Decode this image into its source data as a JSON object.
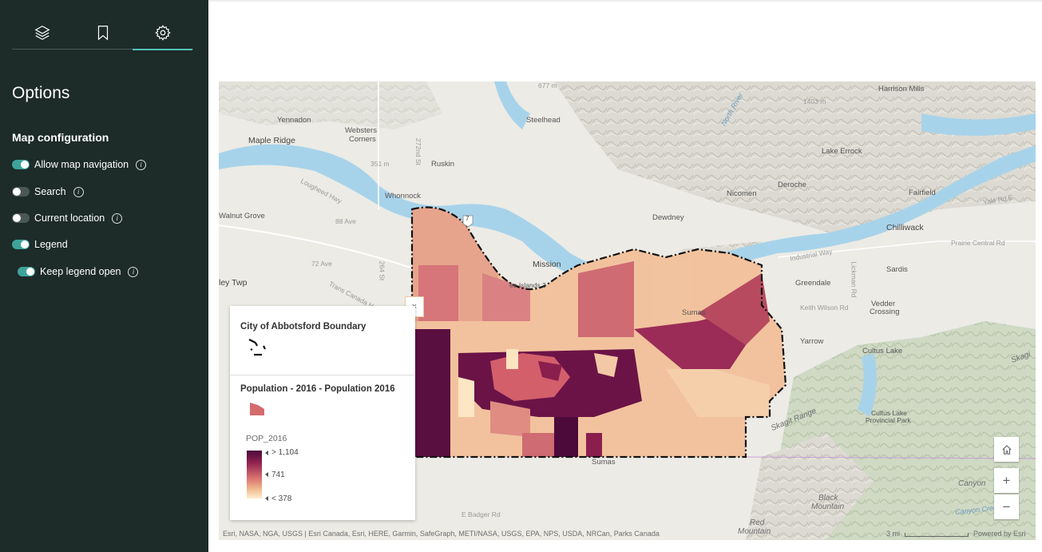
{
  "sidebar": {
    "tabs": [
      {
        "icon": "layers-icon"
      },
      {
        "icon": "bookmark-icon"
      },
      {
        "icon": "gear-icon"
      }
    ],
    "title": "Options",
    "section": "Map configuration",
    "options": [
      {
        "label": "Allow map navigation",
        "on": true
      },
      {
        "label": "Search",
        "on": false
      },
      {
        "label": "Current location",
        "on": false
      },
      {
        "label": "Legend",
        "on": true
      },
      {
        "label": "Keep legend open",
        "on": true
      }
    ]
  },
  "map": {
    "places": {
      "yennadon": "Yennadon",
      "maple_ridge": "Maple Ridge",
      "websters_1": "Websters",
      "websters_2": "Corners",
      "ruskin": "Ruskin",
      "steelhead": "Steelhead",
      "whonnock": "Whonnock",
      "walnut_grove": "Walnut Grove",
      "ave_88": "88 Ave",
      "ave_72": "72 Ave",
      "st_272": "272nd St",
      "st_264": "264 St",
      "lougheed": "Lougheed Hwy",
      "trans_canada": "Trans Canada H",
      "ley_twp": "ley Twp",
      "mission": "Mission",
      "dewdney": "Dewdney",
      "nicomen": "Nicomen",
      "deroche": "Deroche",
      "lake_errock": "Lake Errock",
      "harrison_mills": "Harrison Mills",
      "fairfield": "Fairfield",
      "yale_rd": "Yale Rd E",
      "chilliwack": "Chilliwack",
      "prairie_central": "Prairie Central Rd",
      "industrial_way": "Industrial Way",
      "sardis": "Sardis",
      "greendale": "Greendale",
      "lickman": "Lickman Rd",
      "keith_wilson": "Keith Wilson Rd",
      "vedder_1": "Vedder",
      "vedder_2": "Crossing",
      "yarrow": "Yarrow",
      "cultus_lake": "Cultus Lake",
      "cultus_park_1": "Cultus Lake",
      "cultus_park_2": "Provincial Park",
      "skagit_range": "Skagit Range",
      "skag": "Skagi",
      "sumas_1": "Sumas",
      "sumas_2": "Sumas",
      "canyon": "Canyon",
      "canyon_creek": "Canyon Creek",
      "black_1": "Black",
      "black_2": "Mountain",
      "red_1": "Red",
      "red_2": "Mountain",
      "e_badger": "E Badger Rd",
      "islands3": "ee Islands 3",
      "m677": "677 m",
      "m1403": "1403 m",
      "m351": "351 m",
      "north_river": "North River",
      "hwy7": "7"
    },
    "attribution": "Esri, NASA, NGA, USGS | Esri Canada, Esri, HERE, Garmin, SafeGraph, METI/NASA, USGS, EPA, NPS, USDA, NRCan, Parks Canada",
    "scale": "3 mi",
    "powered": "Powered by Esri",
    "zoom_in": "+",
    "zoom_out": "−"
  },
  "legend": {
    "close": "×",
    "layer1_title": "City of Abbotsford Boundary",
    "layer2_title": "Population - 2016 - Population 2016",
    "field": "POP_2016",
    "ramp_high": "> 1,104",
    "ramp_mid": "741",
    "ramp_low": "< 378",
    "colors": [
      "#4c0a3a",
      "#8e2250",
      "#d46b6d",
      "#f1b88e",
      "#fdf0cd"
    ]
  }
}
